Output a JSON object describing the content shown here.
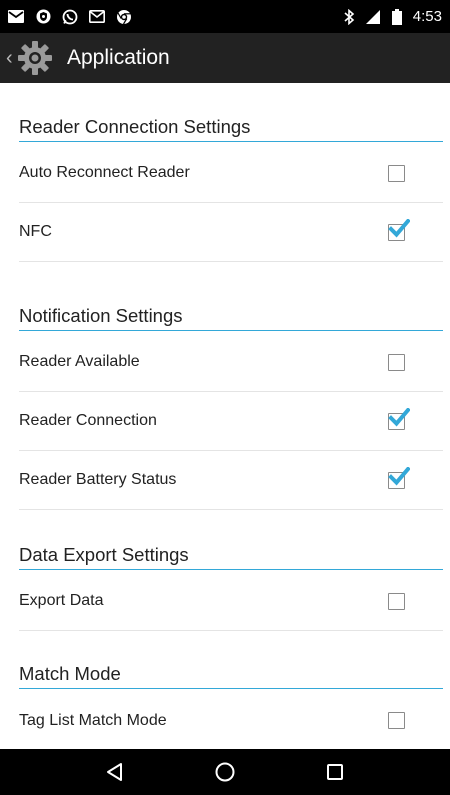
{
  "status_bar": {
    "time": "4:53",
    "icons": [
      "mail-icon",
      "shield-icon",
      "whatsapp-icon",
      "gmail-icon",
      "chrome-icon",
      "bluetooth-icon",
      "signal-icon",
      "battery-icon"
    ]
  },
  "action_bar": {
    "title": "Application",
    "icon": "settings-gear-icon"
  },
  "sections": [
    {
      "header": "Reader Connection Settings",
      "items": [
        {
          "label": "Auto Reconnect Reader",
          "checked": false
        },
        {
          "label": "NFC",
          "checked": true
        }
      ]
    },
    {
      "header": "Notification Settings",
      "items": [
        {
          "label": "Reader Available",
          "checked": false
        },
        {
          "label": "Reader Connection",
          "checked": true
        },
        {
          "label": "Reader Battery Status",
          "checked": true
        }
      ]
    },
    {
      "header": "Data Export Settings",
      "items": [
        {
          "label": "Export Data",
          "checked": false
        }
      ]
    },
    {
      "header": "Match Mode",
      "items": [
        {
          "label": "Tag List Match Mode",
          "checked": false
        }
      ]
    }
  ],
  "nav_bar": {
    "buttons": [
      "back-icon",
      "home-icon",
      "recents-icon"
    ]
  },
  "colors": {
    "accent": "#33a8d8",
    "status_bar": "#000000",
    "action_bar": "#222222"
  }
}
